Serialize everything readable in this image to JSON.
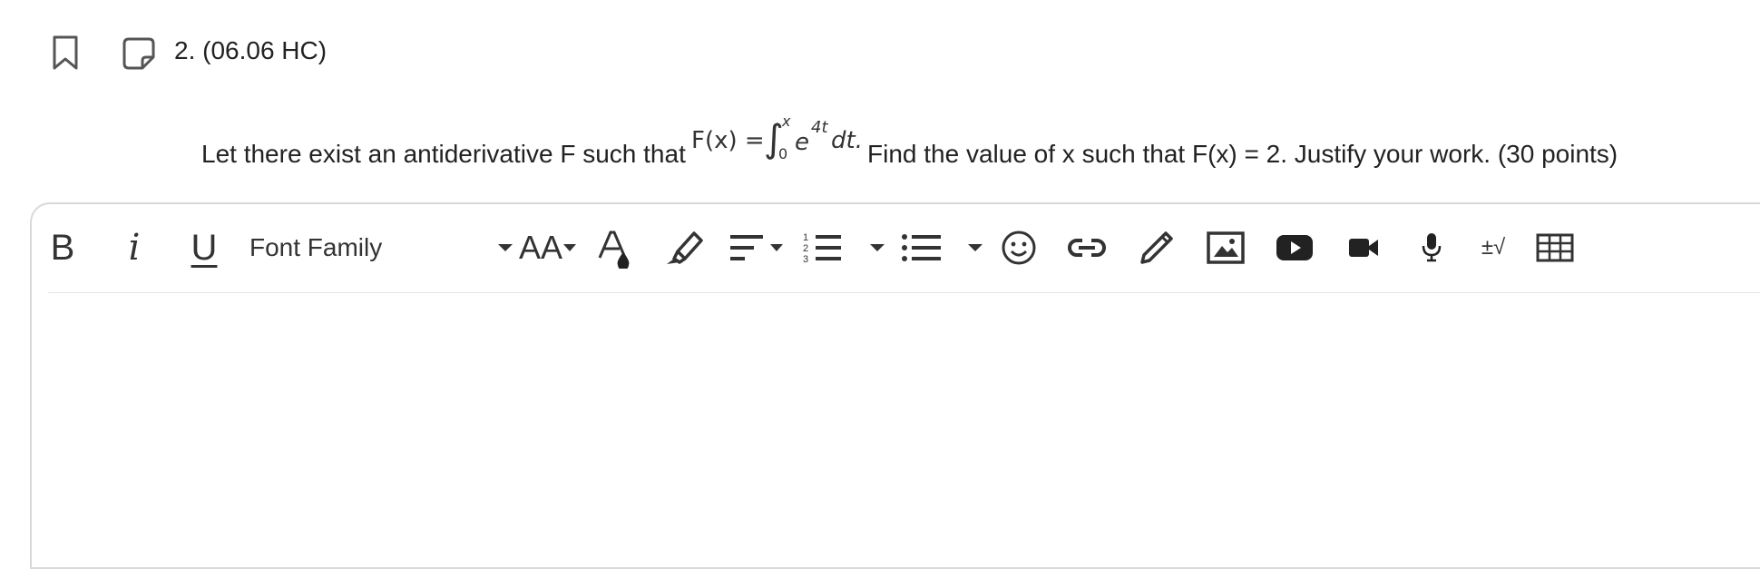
{
  "question": {
    "number_label": "2. (06.06 HC)",
    "prompt_before": "Let there exist an antiderivative F such that",
    "prompt_after": "Find the value of x such that F(x) = 2. Justify your work. (30 points)",
    "formula": {
      "lhs": "F(x) =",
      "integral_symbol": "∫",
      "upper_limit": "x",
      "lower_limit": "0",
      "base": "e",
      "exponent": "4t",
      "differential": "dt."
    }
  },
  "header_icons": {
    "bookmark": "bookmark-icon",
    "note": "note-icon"
  },
  "toolbar": {
    "bold_label": "B",
    "italic_label": "i",
    "underline_label": "U",
    "font_family_label": "Font Family",
    "font_size_label": "AA",
    "math_label": "±√",
    "icons": [
      "text-color-icon",
      "highlighter-icon",
      "align-icon",
      "ordered-list-icon",
      "unordered-list-icon",
      "emoji-icon",
      "link-icon",
      "pencil-icon",
      "image-icon",
      "youtube-icon",
      "video-icon",
      "microphone-icon",
      "table-icon"
    ]
  },
  "editor": {
    "content": ""
  }
}
